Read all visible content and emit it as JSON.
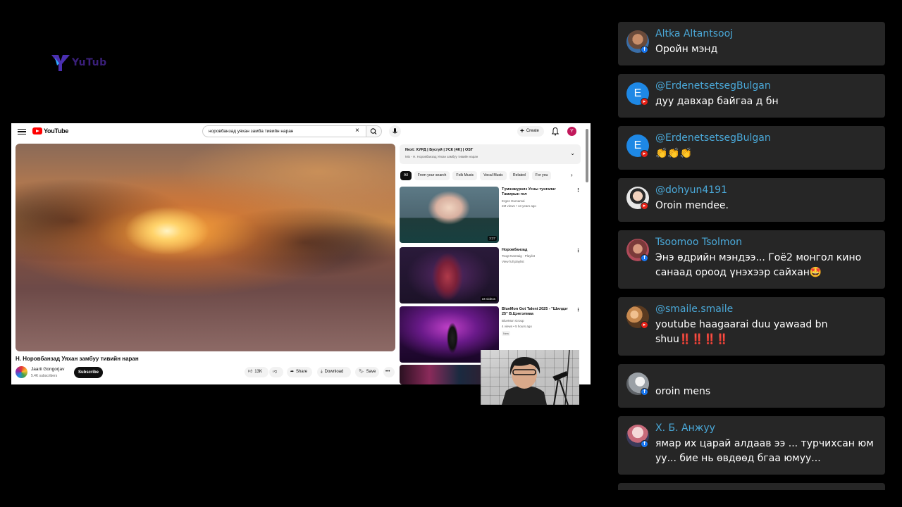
{
  "overlay": {
    "brand_text": "YuTub"
  },
  "youtube": {
    "logo_text": "YouTube",
    "search_query": "норовбанзад уяхан замба тивийн наран",
    "create_label": "Create",
    "avatar_letter": "Y",
    "video_title": "Н. Норовбанзад Уяхан замбуу тивийн наран",
    "channel_name": "Jaarii Gongorjav",
    "channel_subs": "5.4K subscribers",
    "subscribe_label": "Subscribe",
    "likes": "13K",
    "share_label": "Share",
    "download_label": "Download",
    "save_label": "Save",
    "next_title": "Next: ХУРД | Бусгуй | УСК [4K] | OST",
    "next_sub": "Mix - Н. Норовбанзад Уяхан замбуу тивийн наран",
    "chips": [
      "All",
      "From your search",
      "Folk Music",
      "Vocal Music",
      "Related",
      "For you"
    ],
    "recommendations": [
      {
        "title": "Түмэнжүрэлз   Усны тунгалаг Тамирын гол",
        "channel": "Ergen Dursamai",
        "meta": "2M views • 13 years ago",
        "badge": "3:27"
      },
      {
        "title": "Норовбанзад",
        "channel": "Tsogt Namtaig · Playlist",
        "meta": "View full playlist",
        "badge": "34 videos"
      },
      {
        "title": "BlueMon Got Talent 2025 - \"Шилдэг 25\" В.Цэнгэлмаа",
        "channel": "BlueMon Group",
        "meta": "4 views • 5 hours ago",
        "badge": "",
        "tag": "New"
      }
    ]
  },
  "chat": {
    "messages": [
      {
        "name": "Altka Altantsooj",
        "platform": "facebook",
        "text": "Оройн мэнд"
      },
      {
        "name": "@ErdenetsetsegBulgan",
        "platform": "youtube",
        "avatar_letter": "E",
        "text": "дуу давхар байгаа д бн"
      },
      {
        "name": "@ErdenetsetsegBulgan",
        "platform": "youtube",
        "avatar_letter": "E",
        "text": "👏👏👏"
      },
      {
        "name": "@dohyun4191",
        "platform": "youtube",
        "text": "Oroin mendee."
      },
      {
        "name": "Tsoomoo Tsolmon",
        "platform": "facebook",
        "text": "Энэ өдрийн мэндээ... Гоё2 монгол кино санаад ороод үнэхээр сайхан🤩"
      },
      {
        "name": "@smaile.smaile",
        "platform": "youtube",
        "text": "youtube haagaarai duu yawaad bn shuu‼️‼️‼️‼️"
      },
      {
        "name": "",
        "platform": "facebook",
        "text": "oroin mens"
      },
      {
        "name": "Х. Б. Анжуу",
        "platform": "facebook",
        "text": "ямар их царай алдаав ээ ... турчихсан юм уу... бие нь өвдөөд бгаа юмуу..."
      }
    ]
  },
  "colors": {
    "chat_name": "#4aa8d8",
    "chat_bg": "#262626",
    "youtube_red": "#ff0000",
    "facebook_blue": "#1877f2"
  }
}
